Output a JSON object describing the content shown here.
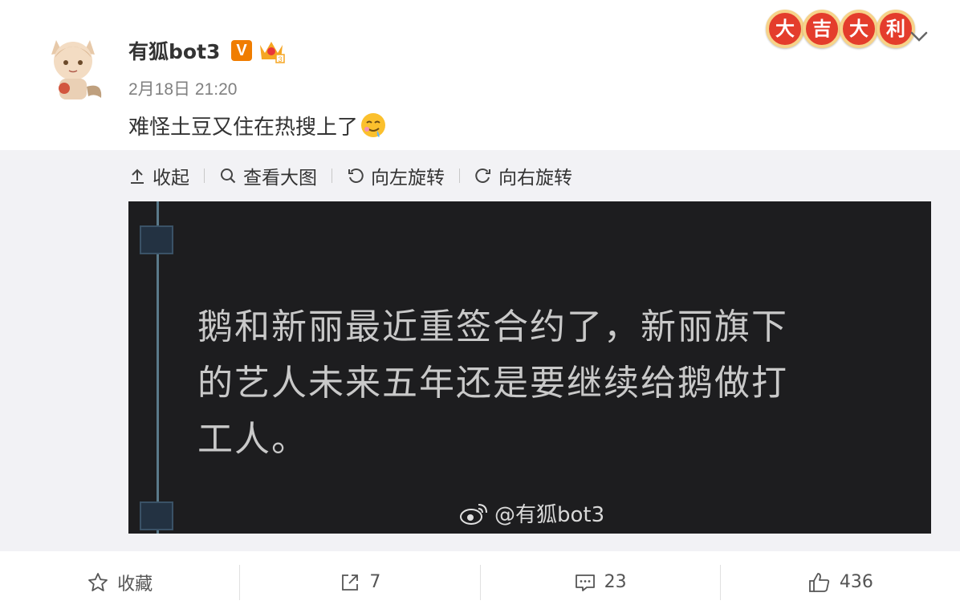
{
  "post": {
    "author": "有狐bot3",
    "verified_badge": "V",
    "timestamp": "2月18日 21:20",
    "text": "难怪土豆又住在热搜上了",
    "emoji": "drooling-face",
    "banner": [
      "大",
      "吉",
      "大",
      "利"
    ]
  },
  "media_toolbar": {
    "collapse": "收起",
    "view_large": "查看大图",
    "rotate_left": "向左旋转",
    "rotate_right": "向右旋转"
  },
  "image": {
    "lines": [
      "鹅和新丽最近重签合约了，新丽旗下",
      "的艺人未来五年还是要继续给鹅做打",
      "工人。"
    ],
    "watermark": "@有狐bot3"
  },
  "actions": {
    "favorite": "收藏",
    "share_count": "7",
    "comment_count": "23",
    "like_count": "436"
  },
  "colors": {
    "accent_orange": "#f07d00",
    "banner_red": "#e43d2c",
    "image_bg": "#1d1d1f",
    "media_bg": "#f2f2f5"
  }
}
